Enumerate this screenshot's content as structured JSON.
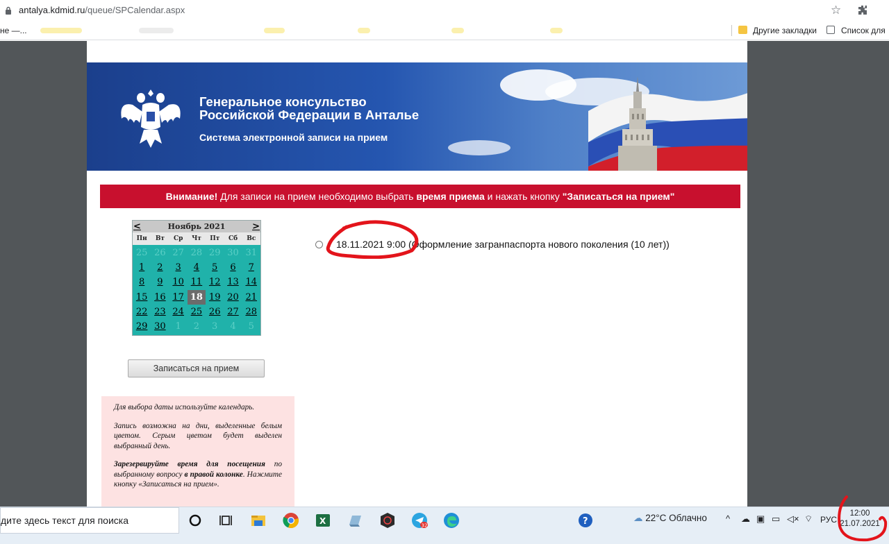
{
  "browser": {
    "url_host": "antalya.kdmid.ru",
    "url_path": "/queue/SPCalendar.aspx",
    "bookmark_first": "не —...",
    "other_bookmarks": "Другие закладки",
    "reading_list": "Список для"
  },
  "banner": {
    "title_line1": "Генеральное консульство",
    "title_line2": "Российской Федерации в Анталье",
    "subtitle": "Система электронной записи на прием"
  },
  "notice": {
    "bold1": "Внимание!",
    "text1": " Для записи на прием необходимо выбрать ",
    "bold2": "время приема",
    "text2": " и нажать кнопку ",
    "bold3": "\"Записаться на прием\""
  },
  "calendar": {
    "prev": "<",
    "next": ">",
    "month": "Ноябрь 2021",
    "weekdays": [
      "Пн",
      "Вт",
      "Ср",
      "Чт",
      "Пт",
      "Сб",
      "Вс"
    ],
    "days": [
      {
        "d": "25",
        "s": "out"
      },
      {
        "d": "26",
        "s": "out"
      },
      {
        "d": "27",
        "s": "out"
      },
      {
        "d": "28",
        "s": "out"
      },
      {
        "d": "29",
        "s": "out"
      },
      {
        "d": "30",
        "s": "out"
      },
      {
        "d": "31",
        "s": "out"
      },
      {
        "d": "1",
        "s": "in"
      },
      {
        "d": "2",
        "s": "in"
      },
      {
        "d": "3",
        "s": "in"
      },
      {
        "d": "4",
        "s": "in"
      },
      {
        "d": "5",
        "s": "in"
      },
      {
        "d": "6",
        "s": "in"
      },
      {
        "d": "7",
        "s": "in"
      },
      {
        "d": "8",
        "s": "in"
      },
      {
        "d": "9",
        "s": "in"
      },
      {
        "d": "10",
        "s": "in"
      },
      {
        "d": "11",
        "s": "in"
      },
      {
        "d": "12",
        "s": "in"
      },
      {
        "d": "13",
        "s": "in"
      },
      {
        "d": "14",
        "s": "in"
      },
      {
        "d": "15",
        "s": "in"
      },
      {
        "d": "16",
        "s": "in"
      },
      {
        "d": "17",
        "s": "in"
      },
      {
        "d": "18",
        "s": "sel"
      },
      {
        "d": "19",
        "s": "in"
      },
      {
        "d": "20",
        "s": "in"
      },
      {
        "d": "21",
        "s": "in"
      },
      {
        "d": "22",
        "s": "in"
      },
      {
        "d": "23",
        "s": "in"
      },
      {
        "d": "24",
        "s": "in"
      },
      {
        "d": "25",
        "s": "in"
      },
      {
        "d": "26",
        "s": "in"
      },
      {
        "d": "27",
        "s": "in"
      },
      {
        "d": "28",
        "s": "in"
      },
      {
        "d": "29",
        "s": "in"
      },
      {
        "d": "30",
        "s": "in"
      },
      {
        "d": "1",
        "s": "out"
      },
      {
        "d": "2",
        "s": "out"
      },
      {
        "d": "3",
        "s": "out"
      },
      {
        "d": "4",
        "s": "out"
      },
      {
        "d": "5",
        "s": "out"
      }
    ]
  },
  "button": {
    "label": "Записаться на прием"
  },
  "info": {
    "p1": "Для выбора даты используйте календарь.",
    "p2": "Запись возможна на дни, выделенные белым цветом. Серым цветом будет выделен выбранный день.",
    "p3_bold": "Зарезервируйте время для посещения",
    "p3_a": " по выбранному вопросу ",
    "p3_bold2": "в правой колонке",
    "p3_b": ". Нажмите кнопку «Записаться на прием»."
  },
  "slot": {
    "label": "18.11.2021 9:00 (Оформление загранпаспорта нового поколения (10 лет))"
  },
  "taskbar": {
    "search_text": "дите здесь текст для поиска",
    "weather": "22°C  Облачно",
    "language": "РУС",
    "time": "12:00",
    "date": "21.07.2021"
  }
}
